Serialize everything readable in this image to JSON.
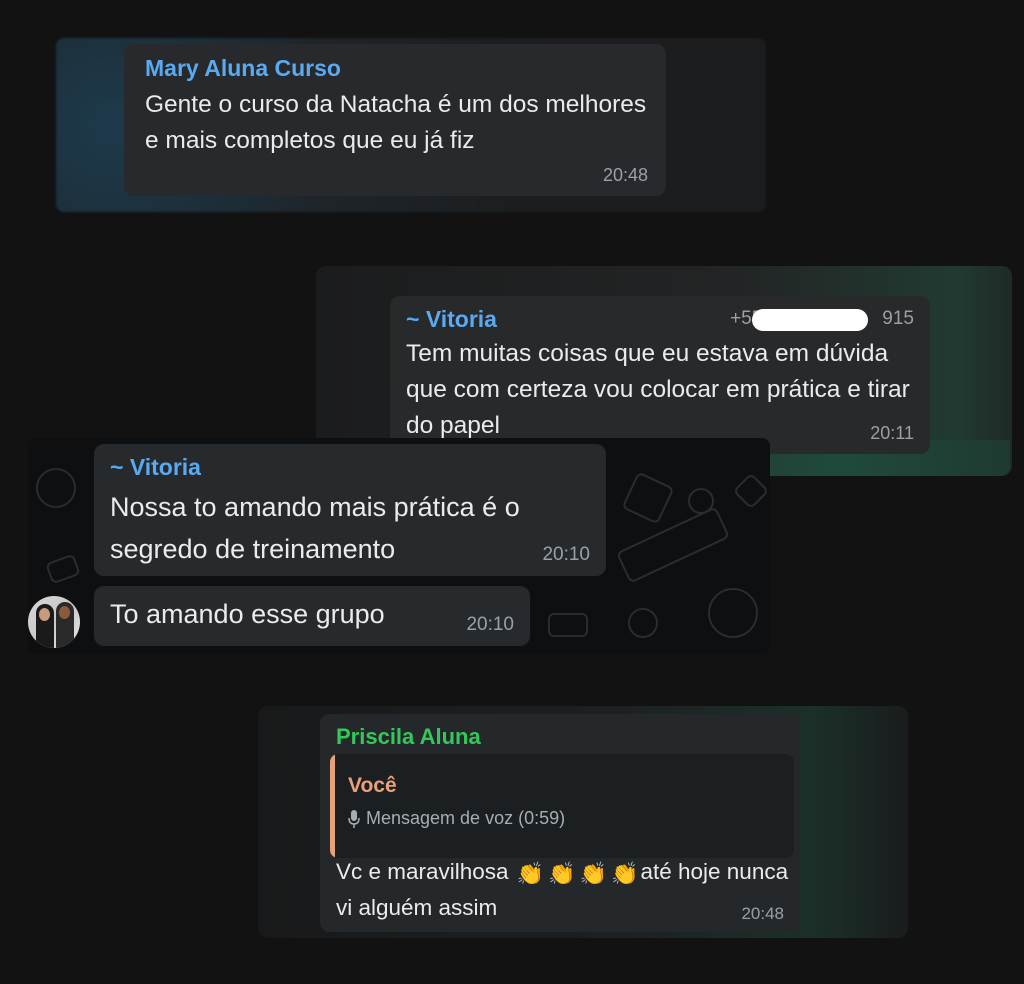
{
  "messages": [
    {
      "sender": "Mary Aluna Curso",
      "text": "Gente o curso da Natacha é um dos melhores e mais completos que eu já fiz",
      "time": "20:48"
    },
    {
      "sender": "~ Vitoria",
      "phone_prefix": "+55",
      "phone_suffix": "915",
      "text": "Tem muitas coisas que eu estava em dúvida que com certeza vou colocar em prática e tirar do papel",
      "time": "20:11"
    },
    {
      "sender": "~ Vitoria",
      "text": "Nossa to amando mais prática é o segredo de treinamento",
      "time": "20:10"
    },
    {
      "text": "To amando esse grupo",
      "time": "20:10"
    },
    {
      "sender": "Priscila Aluna",
      "quote": {
        "author": "Você",
        "text": "Mensagem de voz (0:59)",
        "icon": "mic-icon"
      },
      "text_before": "Vc e maravilhosa",
      "emoji": "👏",
      "text_after": "até hoje nunca vi alguém assim",
      "time": "20:48"
    }
  ],
  "colors": {
    "background": "#121212",
    "bubble": "#25282b",
    "sender_blue": "#5aaaf2",
    "sender_green": "#34c759",
    "quote_accent": "#e7a17a"
  }
}
